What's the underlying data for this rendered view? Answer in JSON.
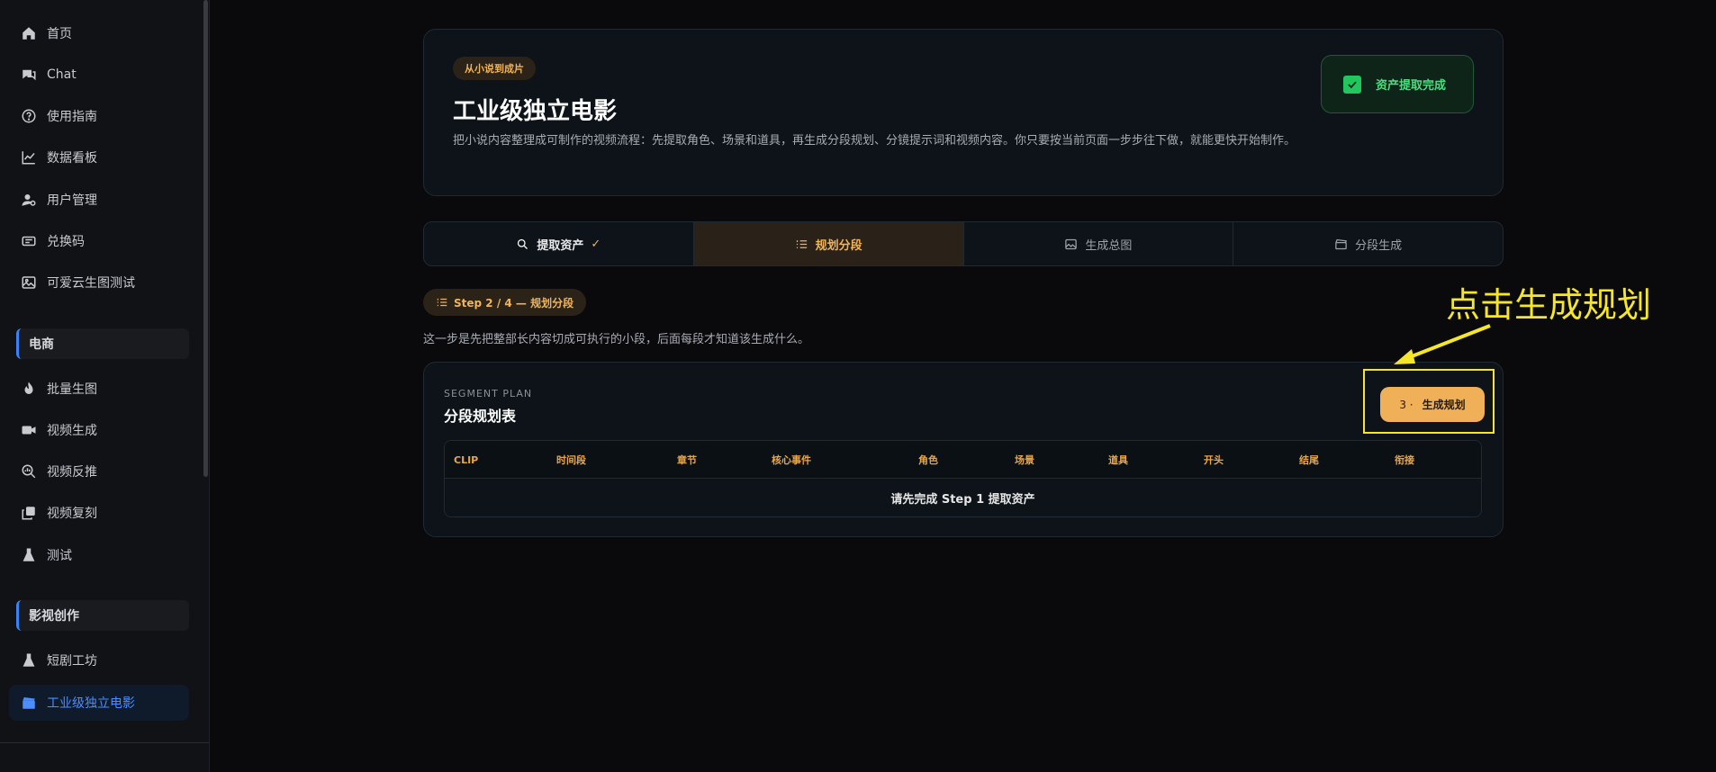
{
  "sidebar": {
    "items": [
      {
        "label": "首页",
        "icon": "home-icon"
      },
      {
        "label": "Chat",
        "icon": "chat-icon"
      },
      {
        "label": "使用指南",
        "icon": "help-icon"
      },
      {
        "label": "数据看板",
        "icon": "chart-icon"
      },
      {
        "label": "用户管理",
        "icon": "user-manage-icon"
      },
      {
        "label": "兑换码",
        "icon": "ticket-icon"
      },
      {
        "label": "可爱云生图测试",
        "icon": "image-icon"
      }
    ],
    "section_ecommerce": "电商",
    "ecommerce_items": [
      {
        "label": "批量生图",
        "icon": "flame-icon"
      },
      {
        "label": "视频生成",
        "icon": "video-icon"
      },
      {
        "label": "视频反推",
        "icon": "search-chart-icon"
      },
      {
        "label": "视频复刻",
        "icon": "copy-icon"
      },
      {
        "label": "测试",
        "icon": "flask-icon"
      }
    ],
    "section_film": "影视创作",
    "film_items": [
      {
        "label": "短剧工坊",
        "icon": "flask-icon"
      },
      {
        "label": "工业级独立电影",
        "icon": "clapper-icon",
        "active": true
      }
    ]
  },
  "hero": {
    "tag": "从小说到成片",
    "title": "工业级独立电影",
    "description": "把小说内容整理成可制作的视频流程：先提取角色、场景和道具，再生成分段规划、分镜提示词和视频内容。你只要按当前页面一步步往下做，就能更快开始制作。",
    "status": "资产提取完成"
  },
  "tabs": [
    {
      "label": "提取资产",
      "state": "done",
      "tick": "✓"
    },
    {
      "label": "规划分段",
      "state": "active"
    },
    {
      "label": "生成总图",
      "state": "idle"
    },
    {
      "label": "分段生成",
      "state": "idle"
    }
  ],
  "step": {
    "pill": "Step 2 / 4 — 规划分段",
    "description": "这一步是先把整部长内容切成可执行的小段，后面每段才知道该生成什么。"
  },
  "plan": {
    "eyebrow": "SEGMENT PLAN",
    "title": "分段规划表",
    "button_num": "3 ·",
    "button_label": "生成规划",
    "columns": [
      "CLIP",
      "时间段",
      "章节",
      "核心事件",
      "角色",
      "场景",
      "道具",
      "开头",
      "结尾",
      "衔接"
    ],
    "empty_message": "请先完成 Step 1 提取资产"
  },
  "annotation": {
    "text": "点击生成规划"
  },
  "colors": {
    "accent": "#f0b058",
    "active_nav": "#4c8dff",
    "success": "#22c55e",
    "annotation": "#f5e62a"
  }
}
